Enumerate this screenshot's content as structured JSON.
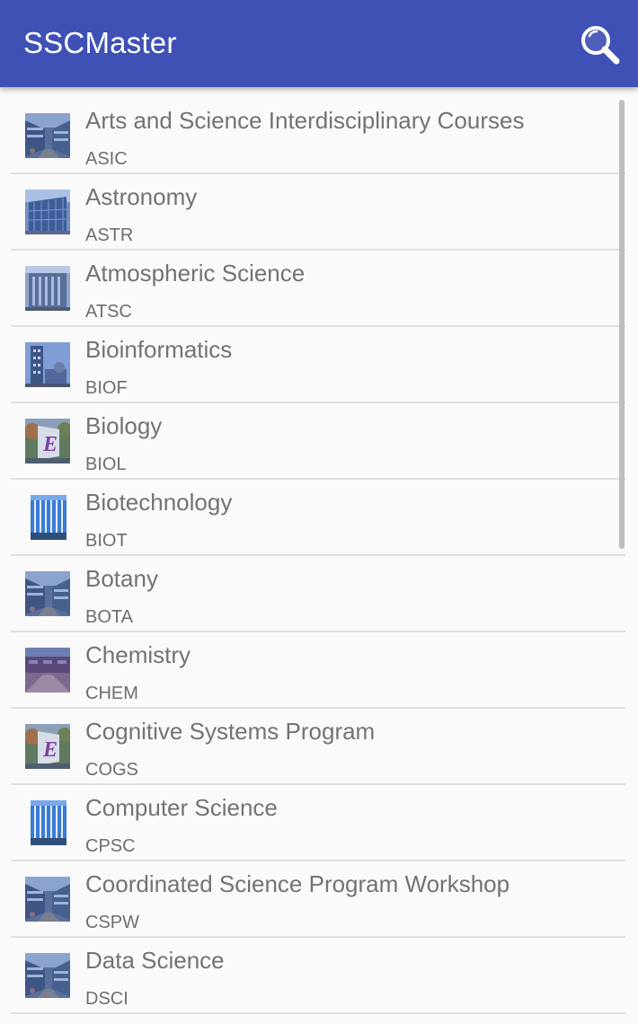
{
  "app_bar": {
    "title": "SSCMaster",
    "search_icon": "search-icon",
    "color": "#3f51b5"
  },
  "subjects": [
    {
      "name": "Arts and Science Interdisciplinary Courses",
      "code": "ASIC",
      "thumb": "campus-walkway"
    },
    {
      "name": "Astronomy",
      "code": "ASTR",
      "thumb": "glass-building"
    },
    {
      "name": "Atmospheric Science",
      "code": "ATSC",
      "thumb": "grey-building"
    },
    {
      "name": "Bioinformatics",
      "code": "BIOF",
      "thumb": "tower-building"
    },
    {
      "name": "Biology",
      "code": "BIOL",
      "thumb": "letter-e-sign"
    },
    {
      "name": "Biotechnology",
      "code": "BIOT",
      "thumb": "white-facade"
    },
    {
      "name": "Botany",
      "code": "BOTA",
      "thumb": "campus-walkway"
    },
    {
      "name": "Chemistry",
      "code": "CHEM",
      "thumb": "brick-courtyard"
    },
    {
      "name": "Cognitive Systems Program",
      "code": "COGS",
      "thumb": "letter-e-sign"
    },
    {
      "name": "Computer Science",
      "code": "CPSC",
      "thumb": "white-facade"
    },
    {
      "name": "Coordinated Science Program Workshop",
      "code": "CSPW",
      "thumb": "campus-walkway"
    },
    {
      "name": "Data Science",
      "code": "DSCI",
      "thumb": "campus-walkway"
    }
  ]
}
